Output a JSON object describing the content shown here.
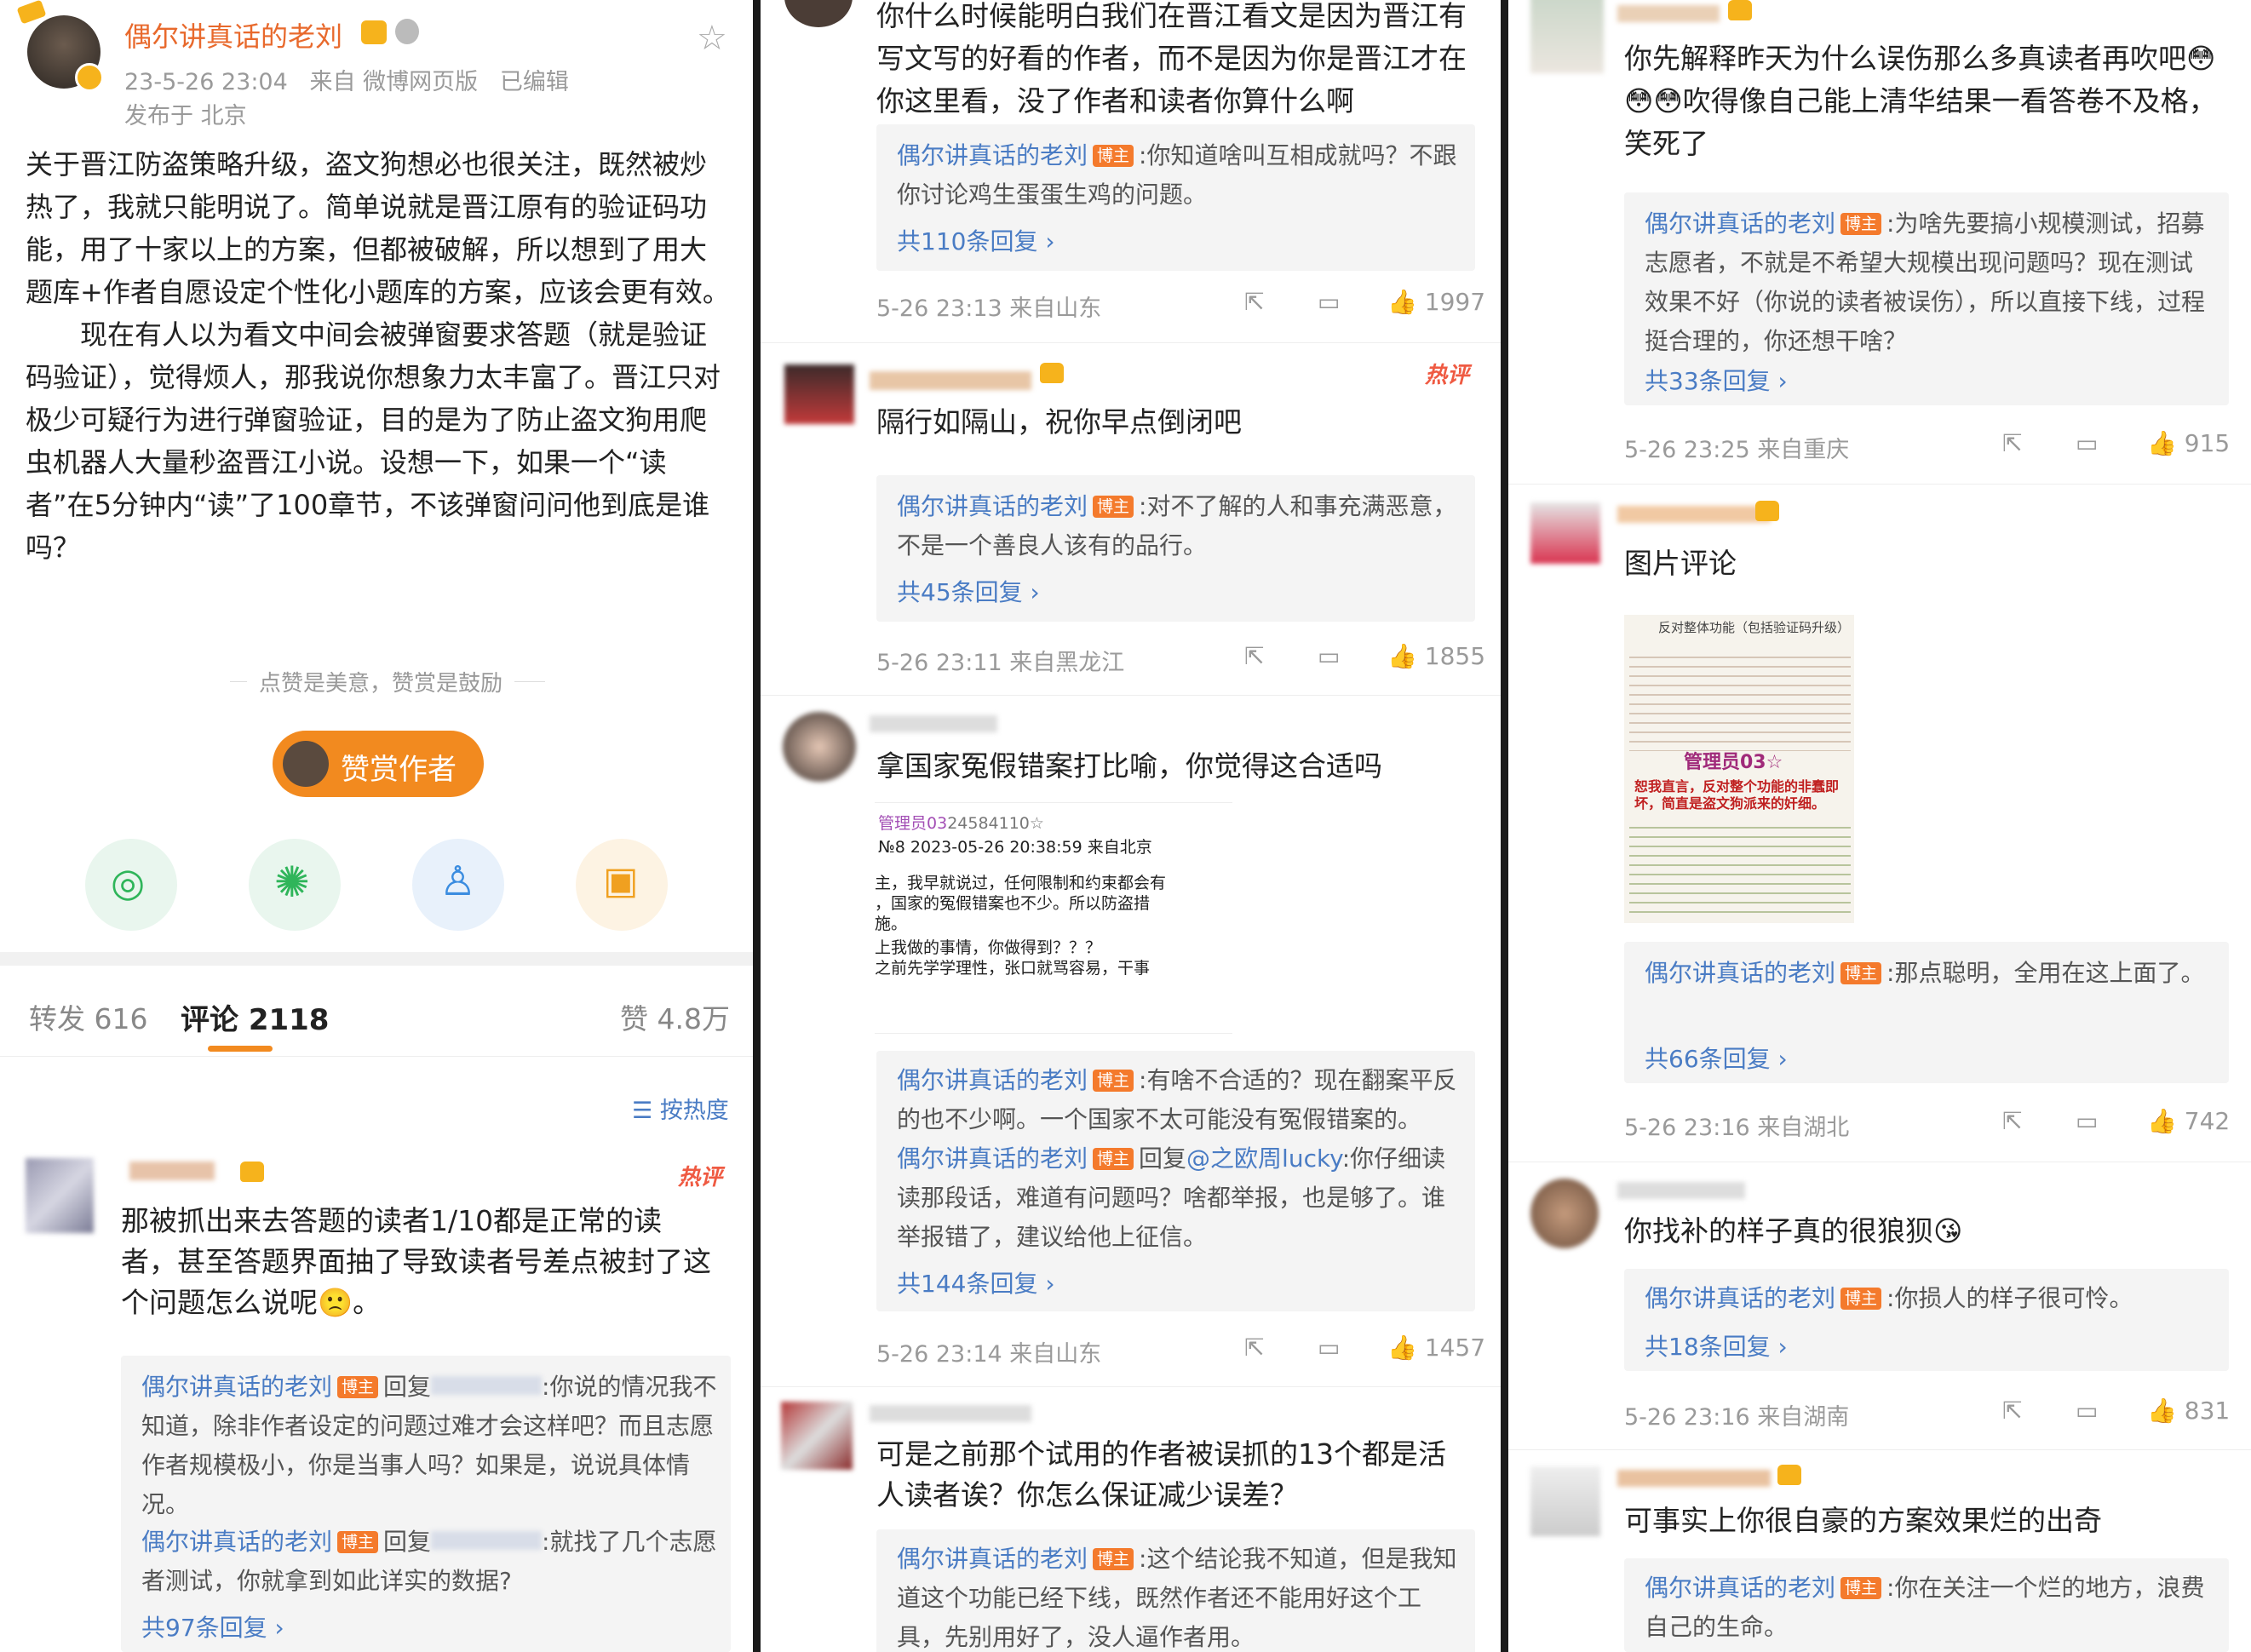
{
  "author": "偶尔讲真话的老刘",
  "badge": "博主",
  "post": {
    "time": "23-5-26 23:04",
    "source": "来自 微博网页版",
    "edited": "已编辑",
    "location": "发布于 北京",
    "p1": "关于晋江防盗策略升级，盗文狗想必也很关注，既然被炒热了，我就只能明说了。简单说就是晋江原有的验证码功能，用了十家以上的方案，但都被破解，所以想到了用大题库+作者自愿设定个性化小题库的方案，应该会更有效。",
    "p2": "现在有人以为看文中间会被弹窗要求答题（就是验证码验证），觉得烦人，那我说你想象力太丰富了。晋江只对极少可疑行为进行弹窗验证，目的是为了防止盗文狗用爬虫机器人大量秒盗晋江小说。设想一下，如果一个“读者”在5分钟内“读”了100章节，不该弹窗问问他到底是谁吗？",
    "tip": "点赞是美意，赞赏是鼓励",
    "reward": "赞赏作者",
    "tabs": {
      "repost": "转发 616",
      "comment": "评论 2118",
      "like": "赞 4.8万"
    },
    "sort": "按热度"
  },
  "hot": "热评",
  "c1": {
    "text": "那被抓出来去答题的读者1/10都是正常的读者，甚至答题界面抽了导致读者号差点被封了这个问题怎么说呢🙁。",
    "r1": "回复",
    "r1t": ":你说的情况我不知道，除非作者设定的问题过难才会这样吧？而且志愿作者规模极小，你是当事人吗？如果是，说说具体情况。",
    "r2t": ":就找了几个志愿者测试，你就拿到如此详实的数据?",
    "more": "共97条回复"
  },
  "c0": {
    "text": "你什么时候能明白我们在晋江看文是因为晋江有写文写的好看的作者，而不是因为你是晋江才在你这里看，没了作者和读者你算什么啊",
    "reply": ":你知道啥叫互相成就吗？不跟你讨论鸡生蛋蛋生鸡的问题。",
    "more": "共110条回复",
    "meta": "5-26 23:13 来自山东",
    "likes": "1997"
  },
  "c2": {
    "text": "隔行如隔山，祝你早点倒闭吧",
    "reply": ":对不了解的人和事充满恶意，不是一个善良人该有的品行。",
    "more": "共45条回复",
    "meta": "5-26 23:11 来自黑龙江",
    "likes": "1855"
  },
  "c3": {
    "text": "拿国家冤假错案打比喻，你觉得这合适吗",
    "img": {
      "l1": "管理员03",
      "l1b": "24584110☆",
      "l2": "№8  2023-05-26 20:38:59 来自北京",
      "l3": "主，我早就说过，任何限制和约束都会有",
      "l4": "，国家的冤假错案也不少。所以防盗措",
      "l5": "施。",
      "l6": "上我做的事情，你做得到？？？",
      "l7": "之前先学学理性，张口就骂容易，干事"
    },
    "reply": ":有啥不合适的？现在翻案平反的也不少啊。一个国家不太可能没有冤假错案的。",
    "reply2a": "回复",
    "reply2b": "@之欧周lucky",
    "reply2t": ":你仔细读读那段话，难道有问题吗？啥都举报，也是够了。谁举报错了，建议给他上征信。",
    "more": "共144条回复",
    "meta": "5-26 23:14 来自山东",
    "likes": "1457"
  },
  "c4": {
    "text": "可是之前那个试用的作者被误抓的13个都是活人读者诶？你怎么保证减少误差？",
    "reply": ":这个结论我不知道，但是我知道这个功能已经下线，既然作者还不能用好这个工具，先别用好了，没人逼作者用。"
  },
  "c5": {
    "text": "你先解释昨天为什么误伤那么多真读者再吹吧😳😳😳吹得像自己能上清华结果一看答卷不及格，笑死了",
    "reply": ":为啥先要搞小规模测试，招募志愿者，不就是不希望大规模出现问题吗？现在测试效果不好（你说的读者被误伤），所以直接下线，过程挺合理的，你还想干啥？",
    "more": "共33条回复",
    "meta": "5-26 23:25 来自重庆",
    "likes": "915"
  },
  "c6": {
    "text": "图片评论",
    "reply": ":那点聪明，全用在这上面了。",
    "more": "共66条回复",
    "meta": "5-26 23:16 来自湖北",
    "likes": "742",
    "img": {
      "t1": "反对整体功能（包括验证码升级）",
      "t2": "管理员03☆",
      "t3": "恕我直言，反对整个功能的非蠢即坏，简直是盗文狗派来的奸细。"
    }
  },
  "c7": {
    "text": "你找补的样子真的很狼狈😘",
    "reply": ":你损人的样子很可怜。",
    "more": "共18条回复",
    "meta": "5-26 23:16 来自湖南",
    "likes": "831"
  },
  "c8": {
    "text": "可事实上你很自豪的方案效果烂的出奇",
    "reply": ":你在关注一个烂的地方，浪费自己的生命。"
  },
  "colors": {
    "link": "#4a7cc4",
    "accent": "#f47a2c",
    "hot": "#ef5a42"
  }
}
